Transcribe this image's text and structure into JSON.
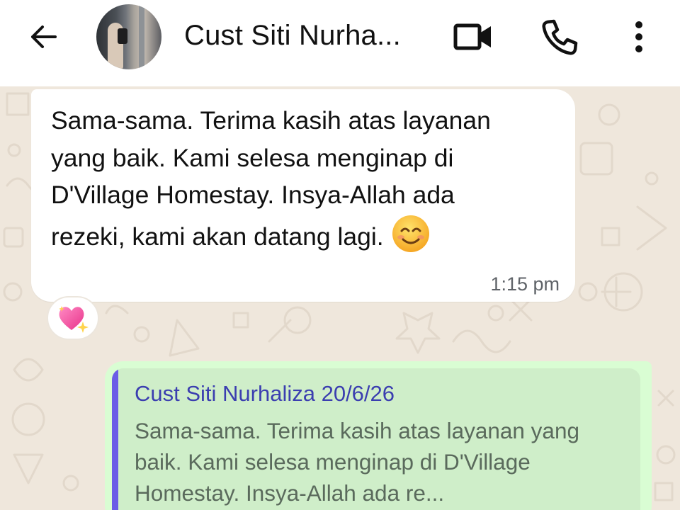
{
  "header": {
    "contact_name": "Cust Siti Nurha...",
    "icons": [
      "back-arrow-icon",
      "video-call-icon",
      "voice-call-icon",
      "more-vert-icon"
    ]
  },
  "messages": {
    "incoming": {
      "text": "Sama-sama. Terima kasih atas layanan yang baik. Kami selesa menginap di D'Village Homestay. Insya-Allah ada rezeki, kami akan datang lagi.",
      "emoji": "smiling-face-emoji",
      "time": "1:15 pm",
      "reaction": "sparkling-heart-emoji"
    },
    "outgoing": {
      "quoted_name": "Cust Siti Nurhaliza 20/6/26",
      "quoted_text": "Sama-sama. Terima kasih atas layanan yang baik. Kami selesa menginap di D'Village Homestay. Insya-Allah ada re..."
    }
  },
  "colors": {
    "header_bg": "#ffffff",
    "chat_bg": "#efe7dc",
    "incoming_bubble": "#ffffff",
    "outgoing_bubble": "#d9fdd3",
    "quote_accent": "#6b5ce7",
    "quote_name": "#3b3eb0"
  }
}
